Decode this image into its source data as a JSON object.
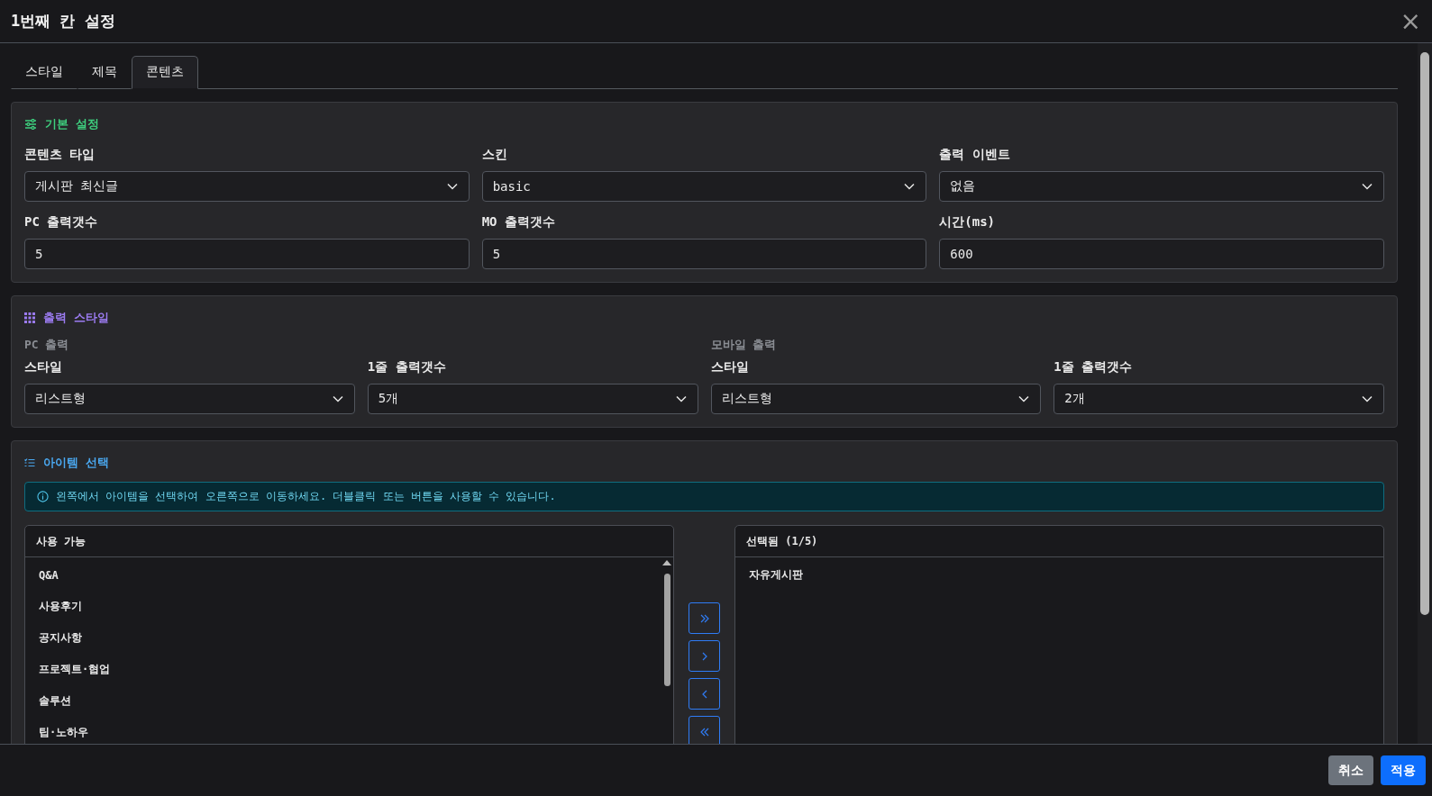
{
  "dialog": {
    "title": "1번째 칸 설정",
    "close": "×"
  },
  "tabs": [
    {
      "label": "스타일",
      "selected": false
    },
    {
      "label": "제목",
      "selected": false
    },
    {
      "label": "콘텐츠",
      "selected": true
    }
  ],
  "basic_settings": {
    "title": "기본 설정",
    "fields": [
      {
        "kind": "select",
        "label": "콘텐츠 타입",
        "value": "게시판 최신글"
      },
      {
        "kind": "select",
        "label": "스킨",
        "value": "basic"
      },
      {
        "kind": "select",
        "label": "출력 이벤트",
        "value": "없음"
      },
      {
        "kind": "input",
        "label": "PC 출력갯수",
        "value": "5"
      },
      {
        "kind": "input",
        "label": "MO 출력갯수",
        "value": "5"
      },
      {
        "kind": "input",
        "label": "시간(ms)",
        "value": "600"
      }
    ]
  },
  "output_style": {
    "title": "출력 스타일",
    "groups": [
      {
        "title": "PC 출력",
        "fields": [
          {
            "label": "스타일",
            "value": "리스트형"
          },
          {
            "label": "1줄 출력갯수",
            "value": "5개"
          }
        ]
      },
      {
        "title": "모바일 출력",
        "fields": [
          {
            "label": "스타일",
            "value": "리스트형"
          },
          {
            "label": "1줄 출력갯수",
            "value": "2개"
          }
        ]
      }
    ]
  },
  "item_selection": {
    "title": "아이템 선택",
    "info": "왼쪽에서 아이템을 선택하여 오른쪽으로 이동하세요. 더블클릭 또는 버튼을 사용할 수 있습니다.",
    "available": {
      "title": "사용 가능",
      "items": [
        "Q&A",
        "사용후기",
        "공지사항",
        "프로젝트·협업",
        "솔루션",
        "팁·노하우"
      ]
    },
    "move_buttons": [
      {
        "kind": "all-right"
      },
      {
        "kind": "right"
      },
      {
        "kind": "left"
      },
      {
        "kind": "all-left"
      }
    ],
    "selected": {
      "title": "선택됨 (1/5)",
      "items": [
        "자유게시판"
      ]
    }
  },
  "footer": {
    "buttons": [
      {
        "label": "취소",
        "kind": "secondary"
      },
      {
        "label": "적용",
        "kind": "primary"
      }
    ]
  }
}
